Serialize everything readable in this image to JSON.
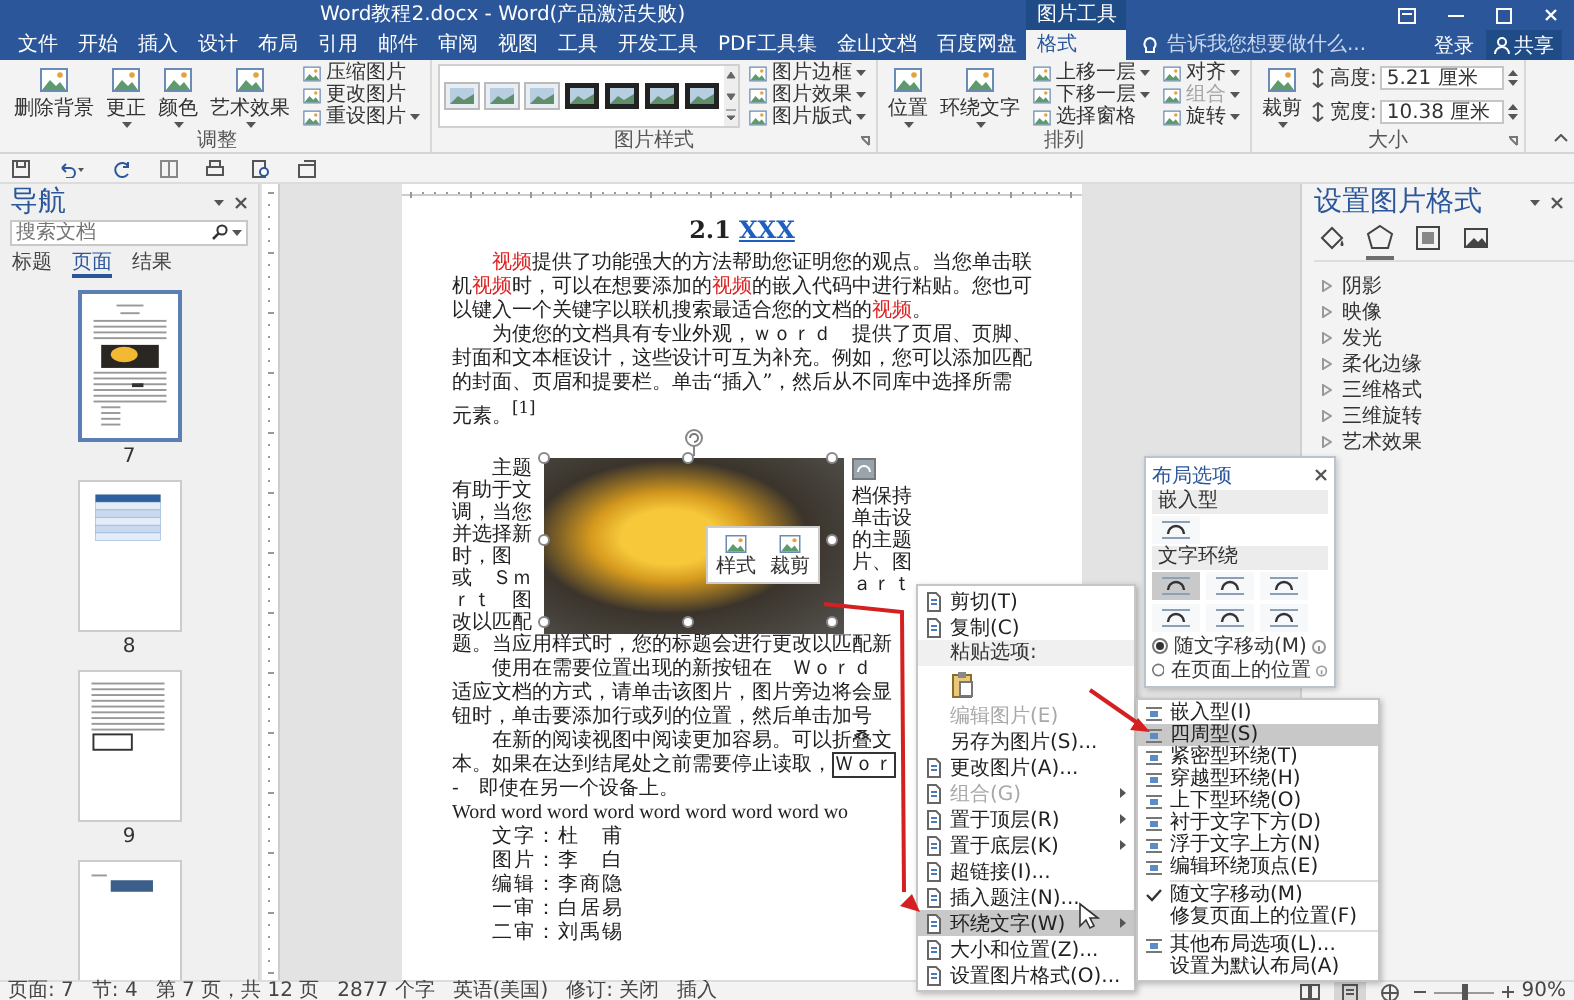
{
  "window": {
    "title": "Word教程2.docx - Word(产品激活失败)"
  },
  "ribbon_tabs": [
    {
      "label": "文件",
      "selected": false
    },
    {
      "label": "开始",
      "selected": false
    },
    {
      "label": "插入",
      "selected": false
    },
    {
      "label": "设计",
      "selected": false
    },
    {
      "label": "布局",
      "selected": false
    },
    {
      "label": "引用",
      "selected": false
    },
    {
      "label": "邮件",
      "selected": false
    },
    {
      "label": "审阅",
      "selected": false
    },
    {
      "label": "视图",
      "selected": false
    },
    {
      "label": "工具",
      "selected": false
    },
    {
      "label": "开发工具",
      "selected": false
    },
    {
      "label": "PDF工具集",
      "selected": false
    },
    {
      "label": "金山文档",
      "selected": false
    },
    {
      "label": "百度网盘",
      "selected": false
    },
    {
      "label": "格式",
      "selected": true,
      "group": "图片工具"
    }
  ],
  "tell_me": {
    "placeholder": "告诉我您想要做什么..."
  },
  "account": {
    "sign_in": "登录",
    "share": "共享"
  },
  "ribbon_groups": [
    {
      "title": "调整",
      "launcher": false,
      "controls": [
        {
          "kind": "large",
          "label": "删除背景",
          "dropdown": false,
          "disabled": false
        },
        {
          "kind": "large",
          "label": "更正",
          "dropdown": true,
          "disabled": false
        },
        {
          "kind": "large",
          "label": "颜色",
          "dropdown": true,
          "disabled": false
        },
        {
          "kind": "large",
          "label": "艺术效果",
          "dropdown": true,
          "disabled": false
        },
        {
          "kind": "small",
          "label": "压缩图片",
          "dropdown": false,
          "disabled": false
        },
        {
          "kind": "small",
          "label": "更改图片",
          "dropdown": false,
          "disabled": false
        },
        {
          "kind": "small",
          "label": "重设图片",
          "dropdown": true,
          "disabled": false
        }
      ]
    },
    {
      "title": "图片样式",
      "launcher": true,
      "controls": [
        {
          "kind": "gallery"
        },
        {
          "kind": "small",
          "label": "图片边框",
          "dropdown": true,
          "disabled": false
        },
        {
          "kind": "small",
          "label": "图片效果",
          "dropdown": true,
          "disabled": false
        },
        {
          "kind": "small",
          "label": "图片版式",
          "dropdown": true,
          "disabled": false
        }
      ]
    },
    {
      "title": "排列",
      "launcher": false,
      "controls": [
        {
          "kind": "large",
          "label": "位置",
          "dropdown": true,
          "disabled": false
        },
        {
          "kind": "large",
          "label": "环绕文字",
          "dropdown": true,
          "disabled": false
        },
        {
          "kind": "small",
          "label": "上移一层",
          "dropdown": true,
          "disabled": false
        },
        {
          "kind": "small",
          "label": "下移一层",
          "dropdown": true,
          "disabled": false
        },
        {
          "kind": "small",
          "label": "选择窗格",
          "dropdown": false,
          "disabled": false
        },
        {
          "kind": "small",
          "label": "对齐",
          "dropdown": true,
          "disabled": false
        },
        {
          "kind": "small",
          "label": "组合",
          "dropdown": true,
          "disabled": true
        },
        {
          "kind": "small",
          "label": "旋转",
          "dropdown": true,
          "disabled": false
        }
      ]
    },
    {
      "title": "大小",
      "launcher": true,
      "controls": [
        {
          "kind": "large",
          "label": "裁剪",
          "dropdown": true,
          "disabled": false
        },
        {
          "kind": "field",
          "label": "高度:",
          "value": "5.21 厘米"
        },
        {
          "kind": "field",
          "label": "宽度:",
          "value": "10.38 厘米"
        }
      ]
    }
  ],
  "navigation": {
    "title": "导航",
    "search": {
      "placeholder": "搜索文档"
    },
    "tabs": [
      {
        "label": "标题",
        "selected": false
      },
      {
        "label": "页面",
        "selected": true
      },
      {
        "label": "结果",
        "selected": false
      }
    ],
    "pages": [
      {
        "number": "7",
        "kind": "text-photo",
        "selected": true
      },
      {
        "number": "8",
        "kind": "table",
        "selected": false
      },
      {
        "number": "9",
        "kind": "text-box",
        "selected": false
      },
      {
        "kind": "banner",
        "selected": false
      }
    ]
  },
  "document": {
    "heading": {
      "number": "2.1",
      "link": "XXX"
    },
    "paragraphs": [
      {
        "indent": true,
        "runs": [
          {
            "text": "视频",
            "highlight": true
          },
          {
            "text": "提供了功能强大的方法帮助您证明您的观点。当您单击联机",
            "highlight": false
          },
          {
            "text": "视频",
            "highlight": true
          },
          {
            "text": "时，可以在想要添加的",
            "highlight": false
          },
          {
            "text": "视频",
            "highlight": true
          },
          {
            "text": "的嵌入代码中进行粘贴。您也可以键入一个关键字以联机搜索最适合您的文档的",
            "highlight": false
          },
          {
            "text": "视频",
            "highlight": true
          },
          {
            "text": "。",
            "highlight": false
          }
        ]
      },
      {
        "indent": true,
        "runs": [
          {
            "text": "为使您的文档具有专业外观，ｗｏｒｄ　提供了页眉、页脚、封面和文本框设计，这些设计可互为补充。例如，您可以添加匹配的封面、页眉和提要栏。单击“插入”，然后从不同库中选择所需元素。$^{[1]}$",
            "highlight": false
          }
        ]
      }
    ],
    "wrap_left": [
      {
        "text": "主题",
        "indent": true
      },
      {
        "text": "有助于文",
        "indent": false
      },
      {
        "text": "调，当您",
        "indent": false
      },
      {
        "text": "并选择新",
        "indent": false
      },
      {
        "text": "时，图",
        "indent": false
      },
      {
        "text": "或　Ｓｍ",
        "indent": false
      },
      {
        "text": "ｒｔ　图",
        "indent": false
      },
      {
        "text": "改以匹配",
        "indent": false
      }
    ],
    "wrap_right": [
      "档保持",
      "单击设",
      "的主题",
      "片、图",
      "ａｒｔ"
    ],
    "mini_toolbar": [
      {
        "label": "样式"
      },
      {
        "label": "裁剪"
      }
    ],
    "lines": [
      {
        "kind": "cjk",
        "indent": false,
        "runs": [
          {
            "text": "题。当应用样式时，您的标题会进行更改以匹配新",
            "boxed": false
          }
        ]
      },
      {
        "kind": "cjk",
        "indent": true,
        "runs": [
          {
            "text": "使用在需要位置出现的新按钮在　Ｗｏｒｄ",
            "boxed": false
          }
        ]
      },
      {
        "kind": "cjk",
        "indent": false,
        "runs": [
          {
            "text": "适应文档的方式，请单击该图片，图片旁边将会显",
            "boxed": false
          }
        ]
      },
      {
        "kind": "cjk",
        "indent": false,
        "runs": [
          {
            "text": "钮时，单击要添加行或列的位置，然后单击加号",
            "boxed": false
          }
        ]
      },
      {
        "kind": "cjk",
        "indent": true,
        "runs": [
          {
            "text": "在新的阅读视图中阅读更加容易。可以折叠文",
            "boxed": false
          }
        ]
      },
      {
        "kind": "cjk",
        "indent": false,
        "runs": [
          {
            "text": "本。如果在达到结尾处之前需要停止读取，",
            "boxed": false
          },
          {
            "text": "Ｗｏｒ",
            "boxed": true
          }
        ]
      },
      {
        "kind": "cjk",
        "indent": false,
        "runs": [
          {
            "text": "-　即使在另一个设备上。",
            "boxed": false
          }
        ]
      },
      {
        "kind": "latin",
        "indent": false,
        "runs": [
          {
            "text": "Word word word word word word word word wo",
            "boxed": false
          }
        ]
      }
    ],
    "credits": [
      "文字：杜　甫",
      "图片：李　白",
      "编辑：李商隐",
      "一审：白居易",
      "二审：刘禹锡"
    ]
  },
  "layout_options": {
    "title": "布局选项",
    "groups": [
      {
        "title": "嵌入型",
        "options": [
          {
            "selected": false
          }
        ]
      },
      {
        "title": "文字环绕",
        "options": [
          {
            "selected": true
          },
          {
            "selected": false
          },
          {
            "selected": false
          },
          {
            "selected": false
          },
          {
            "selected": false
          },
          {
            "selected": false
          }
        ]
      }
    ],
    "radios": [
      {
        "label": "随文字移动(M)",
        "selected": true
      },
      {
        "label": "在页面上的位置",
        "selected": false
      }
    ]
  },
  "context_menu": [
    {
      "kind": "item",
      "label": "剪切(T)",
      "icon": true,
      "disabled": false,
      "submenu": false,
      "selected": false
    },
    {
      "kind": "item",
      "label": "复制(C)",
      "icon": true,
      "disabled": false,
      "submenu": false,
      "selected": false
    },
    {
      "kind": "header",
      "label": "粘贴选项:"
    },
    {
      "kind": "paste"
    },
    {
      "kind": "item",
      "label": "编辑图片(E)",
      "icon": false,
      "disabled": true,
      "submenu": false,
      "selected": false
    },
    {
      "kind": "item",
      "label": "另存为图片(S)...",
      "icon": false,
      "disabled": false,
      "submenu": false,
      "selected": false
    },
    {
      "kind": "item",
      "label": "更改图片(A)...",
      "icon": true,
      "disabled": false,
      "submenu": false,
      "selected": false
    },
    {
      "kind": "item",
      "label": "组合(G)",
      "icon": true,
      "disabled": true,
      "submenu": true,
      "selected": false
    },
    {
      "kind": "item",
      "label": "置于顶层(R)",
      "icon": true,
      "disabled": false,
      "submenu": true,
      "selected": false
    },
    {
      "kind": "item",
      "label": "置于底层(K)",
      "icon": true,
      "disabled": false,
      "submenu": true,
      "selected": false
    },
    {
      "kind": "item",
      "label": "超链接(I)...",
      "icon": true,
      "disabled": false,
      "submenu": false,
      "selected": false
    },
    {
      "kind": "item",
      "label": "插入题注(N)...",
      "icon": true,
      "disabled": false,
      "submenu": false,
      "selected": false
    },
    {
      "kind": "item",
      "label": "环绕文字(W)",
      "icon": true,
      "disabled": false,
      "submenu": true,
      "selected": true
    },
    {
      "kind": "item",
      "label": "大小和位置(Z)...",
      "icon": true,
      "disabled": false,
      "submenu": false,
      "selected": false
    },
    {
      "kind": "item",
      "label": "设置图片格式(O)...",
      "icon": true,
      "disabled": false,
      "submenu": false,
      "selected": false
    }
  ],
  "wrap_submenu": [
    {
      "kind": "wrap",
      "label": "嵌入型(I)",
      "icon": true,
      "selected": false
    },
    {
      "kind": "wrap",
      "label": "四周型(S)",
      "icon": true,
      "selected": true
    },
    {
      "kind": "wrap",
      "label": "紧密型环绕(T)",
      "icon": true,
      "selected": false
    },
    {
      "kind": "wrap",
      "label": "穿越型环绕(H)",
      "icon": true,
      "selected": false
    },
    {
      "kind": "wrap",
      "label": "上下型环绕(O)",
      "icon": true,
      "selected": false
    },
    {
      "kind": "wrap",
      "label": "衬于文字下方(D)",
      "icon": true,
      "selected": false
    },
    {
      "kind": "wrap",
      "label": "浮于文字上方(N)",
      "icon": true,
      "selected": false
    },
    {
      "kind": "wrap",
      "label": "编辑环绕顶点(E)",
      "icon": true,
      "selected": false
    },
    {
      "kind": "position",
      "label": "随文字移动(M)",
      "checked": true,
      "selected": false
    },
    {
      "kind": "position",
      "label": "修复页面上的位置(F)",
      "checked": false,
      "selected": false
    },
    {
      "kind": "more",
      "label": "其他布局选项(L)...",
      "icon": true,
      "selected": false
    },
    {
      "kind": "more",
      "label": "设置为默认布局(A)",
      "icon": false,
      "selected": false
    }
  ],
  "format_pane": {
    "title": "设置图片格式",
    "tabs": [
      {
        "kind": "fill",
        "selected": false
      },
      {
        "kind": "effects",
        "selected": true
      },
      {
        "kind": "layout",
        "selected": false
      },
      {
        "kind": "picture",
        "selected": false
      }
    ],
    "sections": [
      {
        "label": "阴影",
        "expanded": false
      },
      {
        "label": "映像",
        "expanded": false
      },
      {
        "label": "发光",
        "expanded": false
      },
      {
        "label": "柔化边缘",
        "expanded": false
      },
      {
        "label": "三维格式",
        "expanded": false
      },
      {
        "label": "三维旋转",
        "expanded": false
      },
      {
        "label": "艺术效果",
        "expanded": false
      }
    ]
  },
  "status_bar": {
    "items": [
      "页面: 7",
      "节: 4",
      "第 7 页，共 12 页",
      "2877 个字",
      "英语(美国)",
      "修订: 关闭",
      "插入"
    ],
    "views": [
      {
        "kind": "read",
        "selected": false
      },
      {
        "kind": "print",
        "selected": true
      },
      {
        "kind": "web",
        "selected": false
      }
    ],
    "zoom": {
      "level": 0.5,
      "reading": "90%"
    }
  }
}
